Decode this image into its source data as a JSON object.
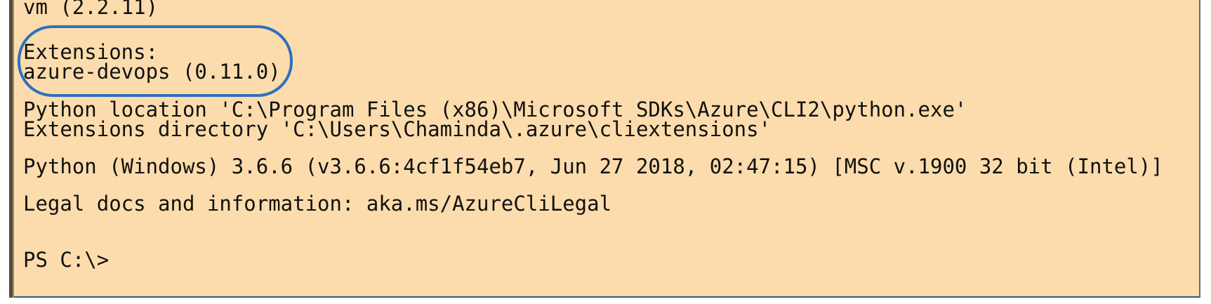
{
  "terminal": {
    "lines": [
      "vm (2.2.11)",
      "Extensions:",
      "azure-devops (0.11.0)",
      "Python location 'C:\\Program Files (x86)\\Microsoft SDKs\\Azure\\CLI2\\python.exe'",
      "Extensions directory 'C:\\Users\\Chaminda\\.azure\\cliextensions'",
      "Python (Windows) 3.6.6 (v3.6.6:4cf1f54eb7, Jun 27 2018, 02:47:15) [MSC v.1900 32 bit (Intel)]",
      "Legal docs and information: aka.ms/AzureCliLegal",
      "PS C:\\>"
    ]
  },
  "colors": {
    "background": "#fcdcac",
    "text": "#111111",
    "highlight": "#2f6fbf"
  }
}
